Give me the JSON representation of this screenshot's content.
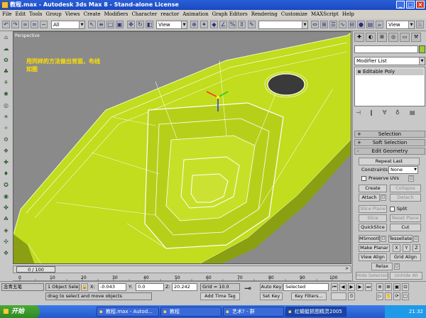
{
  "titlebar": {
    "title": "教程.max - Autodesk 3ds Max 8 - Stand-alone License",
    "minimize": "_",
    "maximize": "□",
    "close": "×"
  },
  "menu": [
    "File",
    "Edit",
    "Tools",
    "Group",
    "Views",
    "Create",
    "Modifiers",
    "Character",
    "reactor",
    "Animation",
    "Graph Editors",
    "Rendering",
    "Customize",
    "MAXScript",
    "Help"
  ],
  "toolbar": {
    "selection_filter": "All",
    "ref_coord": "View",
    "named_selection": "",
    "right_view": "View"
  },
  "viewport": {
    "label": "Perspective",
    "note_line1": "用同样的方法做出背面，布线",
    "note_line2": "如图",
    "mesh_color": "#c2dc1e"
  },
  "panel": {
    "modifier_list": "Modifier List",
    "stack_item": "Editable Poly",
    "rollouts": {
      "selection": "Selection",
      "soft_selection": "Soft Selection",
      "edit_geometry": "Edit Geometry"
    },
    "repeat_last": "Repeat Last",
    "constraints_label": "Constraints:",
    "constraints_value": "None",
    "preserve_uvs": "Preserve UVs",
    "create": "Create",
    "collapse": "Collapse",
    "attach": "Attach",
    "detach": "Detach",
    "slice_plane": "Slice Plane",
    "split": "Split",
    "slice": "Slice",
    "reset_plane": "Reset Plane",
    "quickslice": "QuickSlice",
    "cut": "Cut",
    "msmooth": "MSmooth",
    "tessellate": "Tessellate",
    "make_planar": "Make Planar",
    "x": "X",
    "y": "Y",
    "z": "Z",
    "view_align": "View Align",
    "grid_align": "Grid Align",
    "relax": "Relax",
    "hide_selected": "Hide Selected",
    "unhide_all": "Unhide All"
  },
  "time": {
    "frame": "0 / 100",
    "ticks": [
      "0",
      "10",
      "20",
      "30",
      "40",
      "50",
      "60",
      "70",
      "80",
      "90",
      "100"
    ]
  },
  "status": {
    "ime": "念青五笔",
    "selected": "1 Object Sele",
    "prompt": "drag to select and move objects",
    "x_label": "X:",
    "x_value": "-0.043",
    "y_label": "Y:",
    "y_value": "0.0",
    "z_label": "Z:",
    "z_value": "20.242",
    "grid": "Grid = 10.0",
    "add_time_tag": "Add Time Tag",
    "auto_key": "Auto Key",
    "auto_key_value": "Selected",
    "set_key": "Set Key",
    "key_filters": "Key Filters..."
  },
  "taskbar": {
    "start": "开始",
    "tasks": [
      "教程.max - Autod...",
      "教程",
      "艺术? - 群",
      "红蜻蜓抓图精灵2005"
    ],
    "clock": "21:32"
  }
}
